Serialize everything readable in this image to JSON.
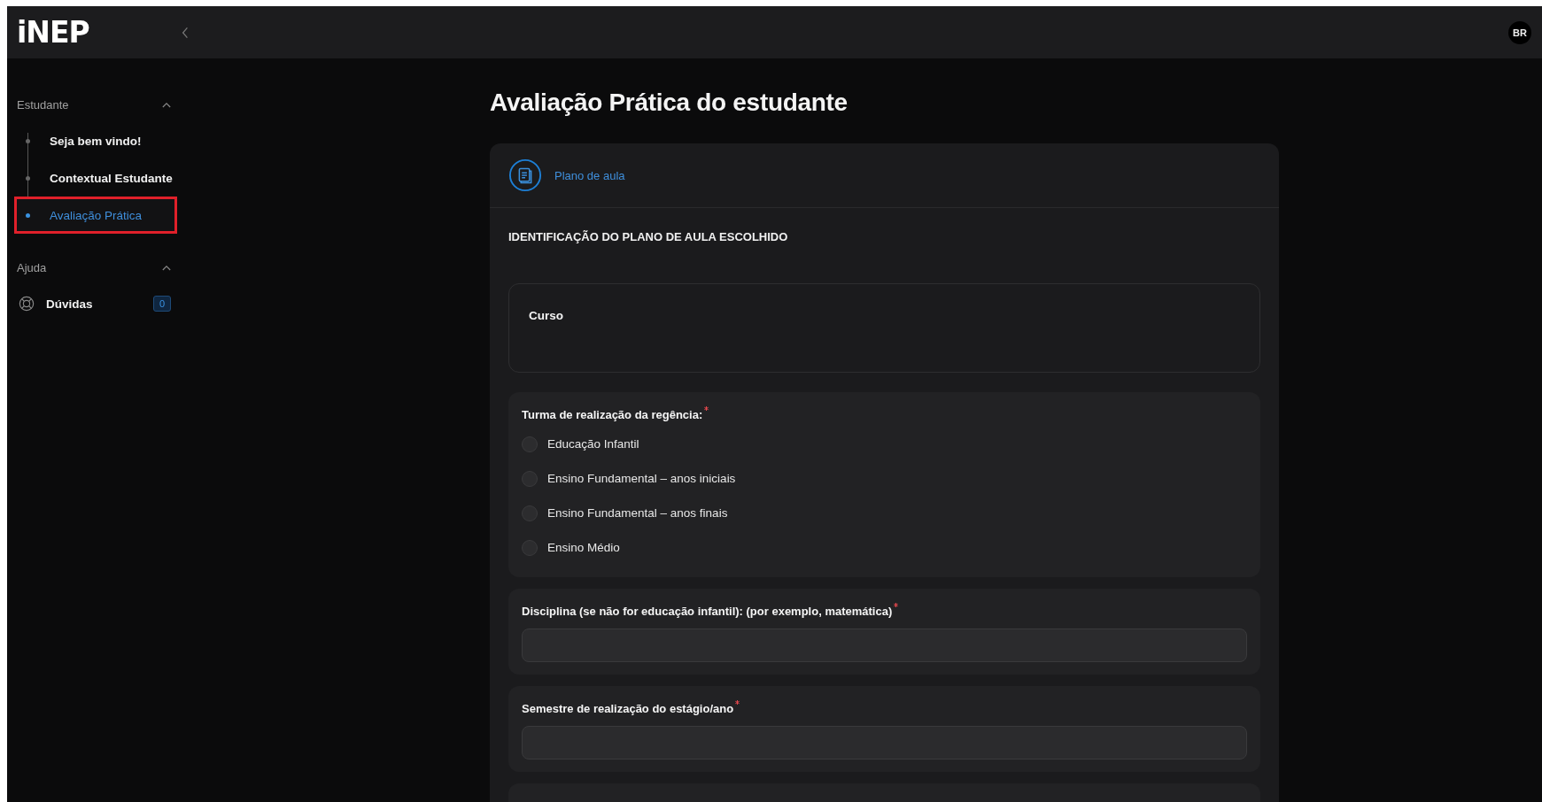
{
  "header": {
    "logo": "iNEP",
    "avatar": "BR"
  },
  "sidebar": {
    "sections": [
      {
        "title": "Estudante",
        "expanded": true,
        "kind": "steps",
        "items": [
          {
            "label": "Seja bem vindo!",
            "selected": false,
            "highlighted": false
          },
          {
            "label": "Contextual Estudante",
            "selected": false,
            "highlighted": false
          },
          {
            "label": "Avaliação Prática",
            "selected": true,
            "highlighted": true
          }
        ]
      },
      {
        "title": "Ajuda",
        "expanded": true,
        "kind": "links",
        "items": [
          {
            "label": "Dúvidas",
            "selected": false,
            "highlighted": false,
            "badge": "0"
          }
        ]
      }
    ]
  },
  "page": {
    "title": "Avaliação Prática do estudante"
  },
  "form": {
    "step": "Plano de aula",
    "section_title": "IDENTIFICAÇÃO DO PLANO DE AULA ESCOLHIDO",
    "fields": [
      {
        "kind": "info",
        "label": "Curso",
        "required": false
      },
      {
        "kind": "radio",
        "label": "Turma de realização da regência:",
        "required": true,
        "options": [
          {
            "label": "Educação Infantil",
            "selected": false
          },
          {
            "label": "Ensino Fundamental – anos iniciais",
            "selected": false
          },
          {
            "label": "Ensino Fundamental – anos finais",
            "selected": false
          },
          {
            "label": "Ensino Médio",
            "selected": false
          }
        ]
      },
      {
        "kind": "text",
        "label": "Disciplina (se não for educação infantil): (por exemplo, matemática)",
        "required": true
      },
      {
        "kind": "text",
        "label": "Semestre de realização do estágio/ano",
        "required": true
      },
      {
        "kind": "cut"
      }
    ]
  }
}
